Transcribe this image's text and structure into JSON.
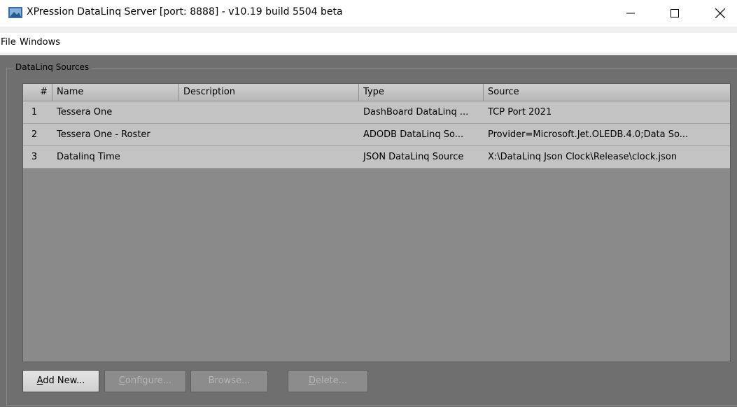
{
  "window": {
    "title": "XPression DataLinq Server [port: 8888] - v10.19 build 5504 beta"
  },
  "menu": {
    "items": [
      {
        "label": "File"
      },
      {
        "label": "Windows"
      }
    ]
  },
  "group": {
    "title": "DataLinq Sources"
  },
  "table": {
    "columns": [
      "#",
      "Name",
      "Description",
      "Type",
      "Source"
    ],
    "rows": [
      {
        "num": "1",
        "name": "Tessera One",
        "description": "",
        "type": "DashBoard DataLinq ...",
        "source": "TCP Port 2021"
      },
      {
        "num": "2",
        "name": "Tessera One - Roster",
        "description": "",
        "type": "ADODB DataLinq So...",
        "source": "Provider=Microsoft.Jet.OLEDB.4.0;Data So..."
      },
      {
        "num": "3",
        "name": "Datalinq Time",
        "description": "",
        "type": "JSON DataLinq Source",
        "source": "X:\\DataLinq Json Clock\\Release\\clock.json"
      }
    ]
  },
  "buttons": {
    "add_new": {
      "access": "A",
      "rest": "dd New..."
    },
    "configure": {
      "access": "C",
      "rest": "onfigure..."
    },
    "browse": {
      "label": "Browse..."
    },
    "delete": {
      "access": "D",
      "rest": "elete..."
    }
  }
}
